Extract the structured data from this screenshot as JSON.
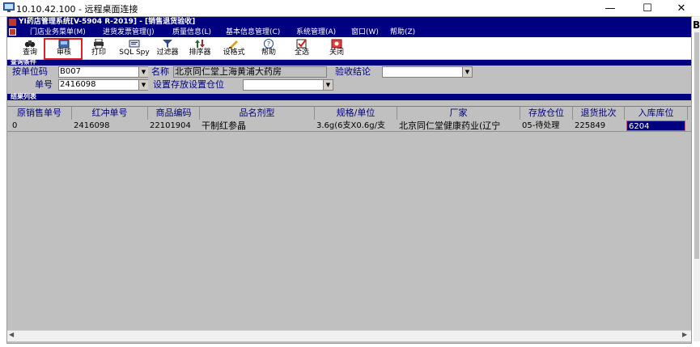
{
  "rdp": {
    "title": "10.10.42.100 - 远程桌面连接",
    "minimize": "—",
    "maximize": "☐",
    "close": "✕"
  },
  "app": {
    "title": "YI药店管理系统[V-5904 R-2019] - [销售退货验收]",
    "edge_letter": "B"
  },
  "menu": [
    "门店业务菜单(M)",
    "进货发票管理(J)",
    "质量信息(L)",
    "基本信息管理(C)",
    "系统管理(A)",
    "窗口(W)",
    "帮助(Z)"
  ],
  "toolbar": [
    {
      "label": "查询",
      "icon": "binoculars-icon"
    },
    {
      "label": "审核",
      "icon": "audit-icon"
    },
    {
      "label": "打印",
      "icon": "printer-icon"
    },
    {
      "label": "SQL Spy",
      "icon": "sql-spy-icon"
    },
    {
      "label": "过滤器",
      "icon": "filter-icon"
    },
    {
      "label": "排序器",
      "icon": "sorter-icon"
    },
    {
      "label": "设格式",
      "icon": "format-icon"
    },
    {
      "label": "帮助",
      "icon": "help-icon"
    },
    {
      "label": "全选",
      "icon": "select-all-icon"
    },
    {
      "label": "关闭",
      "icon": "close-icon"
    }
  ],
  "query": {
    "section_title": "查询条件",
    "unit_code_label": "按单位码",
    "unit_code_value": "B007",
    "name_label": "名称",
    "name_value": "北京同仁堂上海黄浦大药房",
    "result_label": "验收结论",
    "result_value": "",
    "order_no_label": "单号",
    "order_no_value": "2416098",
    "storage_label": "设置存放设置仓位",
    "storage_value": ""
  },
  "results": {
    "section_title": "结果列表",
    "columns": [
      "原销售单号",
      "红冲单号",
      "商品编码",
      "品名剂型",
      "规格/单位",
      "厂家",
      "存放仓位",
      "退货批次",
      "入库库位"
    ],
    "rows": [
      [
        "0",
        "2416098",
        "22101904",
        "干制红参晶",
        "3.6g(6支X0.6g/支",
        "北京同仁堂健康药业(辽宁",
        "05-待处理",
        "225849",
        "6204"
      ]
    ]
  },
  "colors": {
    "title_blue": "#000080",
    "panel_gray": "#c0c0c0",
    "highlight_red": "#e02020"
  }
}
